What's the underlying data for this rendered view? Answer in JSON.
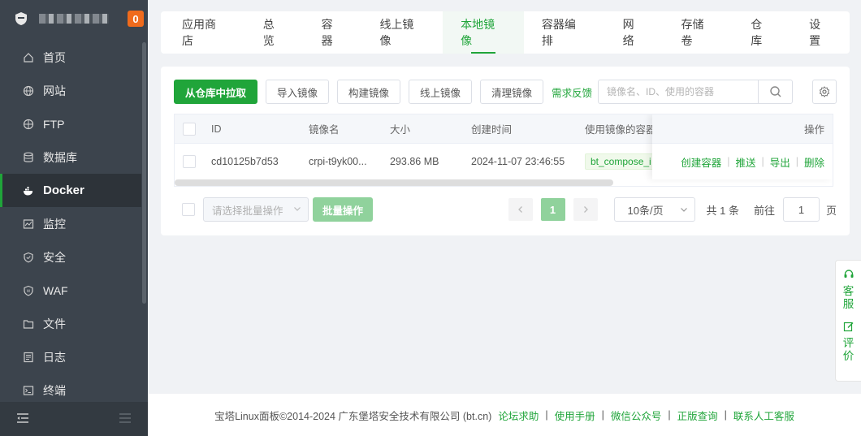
{
  "sidebar": {
    "notice_count": "0",
    "items": [
      {
        "label": "首页",
        "icon": "home-icon"
      },
      {
        "label": "网站",
        "icon": "globe-icon"
      },
      {
        "label": "FTP",
        "icon": "ftp-globe-icon"
      },
      {
        "label": "数据库",
        "icon": "database-icon"
      },
      {
        "label": "Docker",
        "icon": "docker-icon"
      },
      {
        "label": "监控",
        "icon": "monitor-icon"
      },
      {
        "label": "安全",
        "icon": "shield-icon"
      },
      {
        "label": "WAF",
        "icon": "waf-shield-icon"
      },
      {
        "label": "文件",
        "icon": "folder-icon"
      },
      {
        "label": "日志",
        "icon": "log-icon"
      },
      {
        "label": "终端",
        "icon": "terminal-icon"
      }
    ],
    "active_index": 4
  },
  "tabs": [
    "应用商店",
    "总览",
    "容器",
    "线上镜像",
    "本地镜像",
    "容器编排",
    "网络",
    "存储卷",
    "仓库",
    "设置"
  ],
  "active_tab": 4,
  "toolbar": {
    "pull_label": "从仓库中拉取",
    "import_label": "导入镜像",
    "build_label": "构建镜像",
    "online_label": "线上镜像",
    "clean_label": "清理镜像",
    "feedback_label": "需求反馈",
    "search_placeholder": "镜像名、ID、使用的容器"
  },
  "table": {
    "headers": {
      "id": "ID",
      "name": "镜像名",
      "size": "大小",
      "created": "创建时间",
      "used_by": "使用镜像的容器",
      "ops": "操作"
    },
    "rows": [
      {
        "id": "cd10125b7d53",
        "name": "crpi-t9yk00...",
        "size": "293.86 MB",
        "created": "2024-11-07 23:46:55",
        "used_by": "bt_compose_i",
        "actions": [
          "创建容器",
          "推送",
          "导出",
          "删除"
        ]
      }
    ]
  },
  "batch": {
    "select_placeholder": "请选择批量操作",
    "button_label": "批量操作"
  },
  "pagination": {
    "current_page": "1",
    "page_size": "10条/页",
    "total": "共 1 条",
    "goto_label": "前往",
    "goto_value": "1",
    "page_unit": "页"
  },
  "float_panel": {
    "service_label": "客服",
    "review_label": "评价"
  },
  "footer": {
    "copyright": "宝塔Linux面板©2014-2024 广东堡塔安全技术有限公司 (bt.cn)",
    "links": [
      "论坛求助",
      "使用手册",
      "微信公众号",
      "正版查询",
      "联系人工客服"
    ]
  },
  "colors": {
    "brand_green": "#20a53a",
    "sidebar_bg": "#3c444d",
    "badge_orange": "#f06b1c"
  }
}
